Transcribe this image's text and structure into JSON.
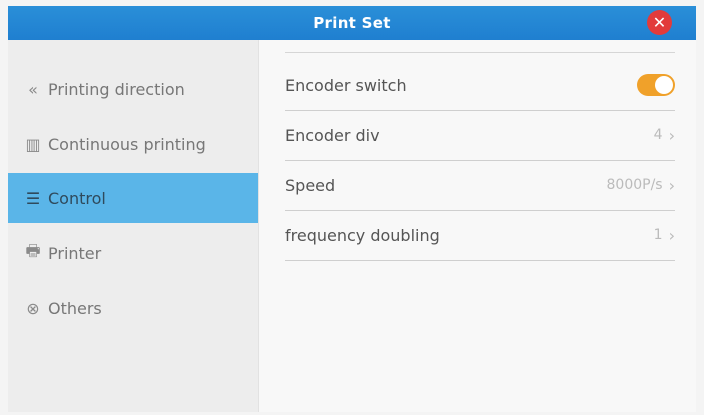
{
  "header": {
    "title": "Print Set",
    "close_icon": "close-icon"
  },
  "sidebar": {
    "items": [
      {
        "icon": "double-chevron-left-icon",
        "glyph": "«",
        "label": "Printing  direction",
        "active": false
      },
      {
        "icon": "continuous-print-icon",
        "glyph": "▥",
        "label": "Continuous  printing",
        "active": false
      },
      {
        "icon": "list-lines-icon",
        "glyph": "☰",
        "label": "Control",
        "active": true
      },
      {
        "icon": "printer-icon",
        "glyph": "🖶",
        "label": "Printer",
        "active": false
      },
      {
        "icon": "others-circle-icon",
        "glyph": "⊗",
        "label": "Others",
        "active": false
      }
    ]
  },
  "settings": {
    "rows": [
      {
        "label": "Encoder  switch",
        "type": "toggle",
        "on": true
      },
      {
        "label": "Encoder  div",
        "value": "4"
      },
      {
        "label": "Speed",
        "value": "8000P/s"
      },
      {
        "label": "frequency  doubling",
        "value": "1"
      }
    ]
  },
  "colors": {
    "header": "#1f7fd0",
    "active_item": "#5ab5e8",
    "toggle_on": "#f0a12a",
    "close": "#e23b3b"
  }
}
